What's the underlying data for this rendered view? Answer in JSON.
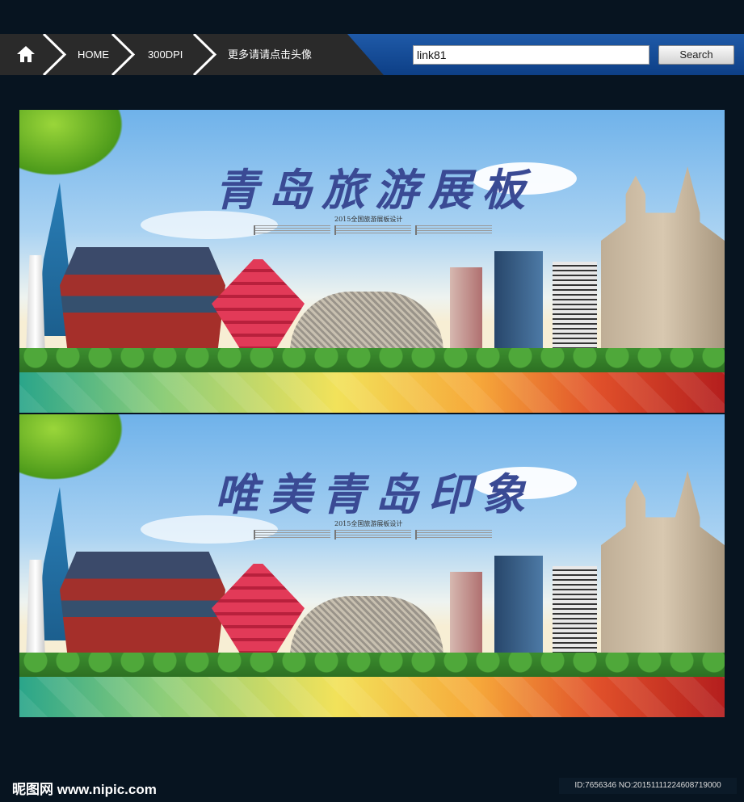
{
  "nav": {
    "home_label": "HOME",
    "dpi_label": "300DPI",
    "more_label": "更多请请点击头像",
    "search_value": "link81",
    "search_button": "Search"
  },
  "panels": [
    {
      "title": "青岛旅游展板",
      "subtitle": "2015全国旅游展板设计"
    },
    {
      "title": "唯美青岛印象",
      "subtitle": "2015全国旅游展板设计"
    }
  ],
  "footer": {
    "logo": "昵图网 www.nipic.com",
    "id": "ID:7656346 NO:20151111224608719000"
  },
  "colors": {
    "title": "#3a4a94",
    "nav_blue": "#1f5aa8",
    "background": "#071420"
  }
}
